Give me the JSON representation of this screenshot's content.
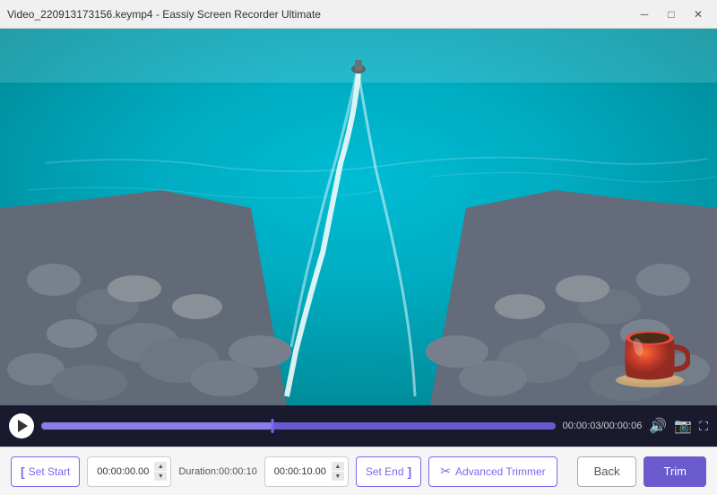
{
  "window": {
    "title": "Video_220913173156.keymp4  -  Eassiy Screen Recorder Ultimate",
    "controls": {
      "minimize": "─",
      "maximize": "□",
      "close": "✕"
    }
  },
  "video": {
    "current_time": "00:00:03",
    "total_time": "00:00:06",
    "progress_percent": 45
  },
  "toolbar": {
    "set_start_label": "Set Start",
    "start_time_value": "00:00:00.00",
    "duration_label": "Duration:",
    "duration_value": "00:00:10",
    "end_time_value": "00:00:10.00",
    "set_end_label": "Set End",
    "advanced_label": "Advanced Trimmer",
    "back_label": "Back",
    "trim_label": "Trim"
  },
  "icons": {
    "play": "play",
    "volume": "🔊",
    "camera": "📷",
    "fullscreen": "⛶",
    "scissors": "✂"
  }
}
